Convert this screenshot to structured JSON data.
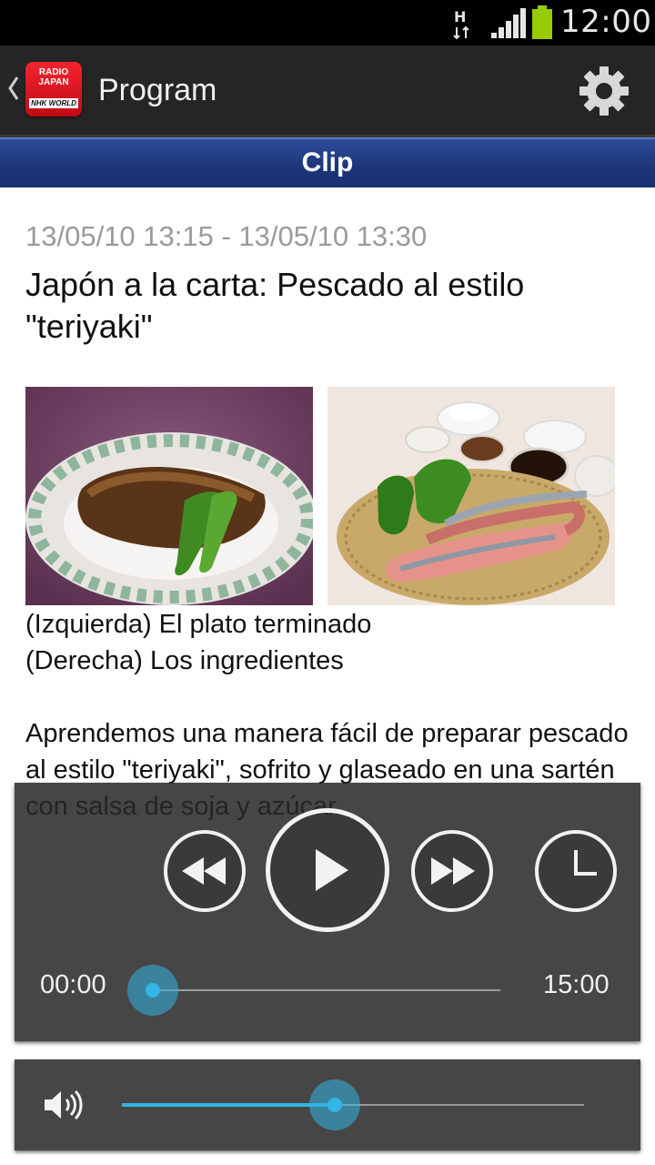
{
  "status_bar": {
    "network_type": "H",
    "time": "12:00",
    "icons": [
      "network-activity-icon",
      "signal-icon",
      "battery-icon"
    ]
  },
  "action_bar": {
    "title": "Program",
    "logo_line1": "RADIO",
    "logo_line2": "JAPAN",
    "logo_line3": "NHK WORLD",
    "icons": [
      "back-chevron-icon",
      "settings-gear-icon"
    ]
  },
  "section": {
    "title": "Clip"
  },
  "program": {
    "datetime": "13/05/10 13:15 - 13/05/10 13:30",
    "title": "Japón a la carta: Pescado al estilo \"teriyaki\"",
    "caption_left": "(Izquierda) El plato terminado",
    "caption_right": "(Derecha) Los ingredientes",
    "description": "Aprendemos una manera fácil de preparar pescado al estilo \"teriyaki\", sofrito y glaseado en una sartén con salsa de soja y azúcar."
  },
  "player": {
    "elapsed": "00:00",
    "total": "15:00",
    "progress": 0,
    "controls": [
      "rewind-icon",
      "play-icon",
      "fast-forward-icon",
      "sleep-timer-icon"
    ]
  },
  "volume": {
    "level": 0.46,
    "icon": "volume-icon"
  },
  "colors": {
    "accent": "#33b5e5",
    "header_blue": "#1d3578",
    "logo_red": "#e31b23"
  }
}
